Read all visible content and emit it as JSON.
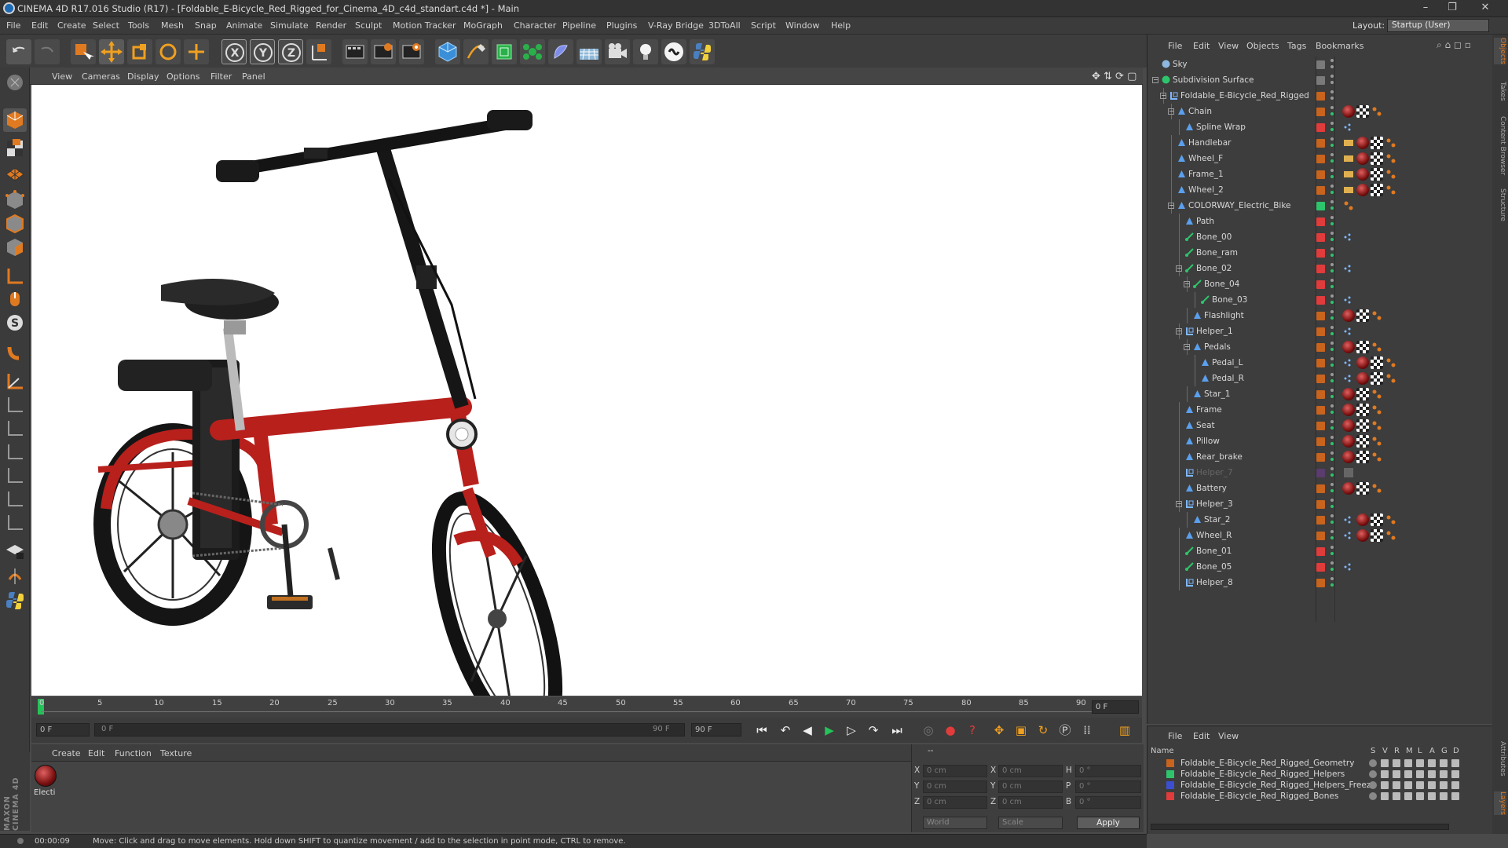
{
  "window": {
    "title": "CINEMA 4D R17.016 Studio (R17) - [Foldable_E-Bicycle_Red_Rigged_for_Cinema_4D_c4d_standart.c4d *] - Main",
    "controls": [
      "–",
      "❐",
      "✕"
    ]
  },
  "menubar": {
    "items": [
      "File",
      "Edit",
      "Create",
      "Select",
      "Tools",
      "Mesh",
      "Snap",
      "Animate",
      "Simulate",
      "Render",
      "Sculpt",
      "Motion Tracker",
      "MoGraph",
      "Character",
      "Pipeline",
      "Plugins",
      "V-Ray Bridge",
      "3DToAll",
      "Script",
      "Window",
      "Help"
    ],
    "layout_label": "Layout:",
    "layout_value": "Startup (User)"
  },
  "toolbar": {
    "axes": [
      "X",
      "Y",
      "Z"
    ]
  },
  "viewport": {
    "menu": [
      "View",
      "Cameras",
      "Display",
      "Options",
      "Filter",
      "Panel"
    ]
  },
  "timeline": {
    "ticks": [
      "0",
      "5",
      "10",
      "15",
      "20",
      "25",
      "30",
      "35",
      "40",
      "45",
      "50",
      "55",
      "60",
      "65",
      "70",
      "75",
      "80",
      "85",
      "90"
    ],
    "current_frame_display": "0 F",
    "start_field": "0 F",
    "range_start": "0 F",
    "range_end": "90 F",
    "end_field": "90 F"
  },
  "materials": {
    "menu": [
      "Create",
      "Edit",
      "Function",
      "Texture"
    ],
    "items": [
      {
        "label": "Electi"
      }
    ]
  },
  "coordinates": {
    "header": "--",
    "labels": {
      "x": "X",
      "y": "Y",
      "z": "Z",
      "x2": "X",
      "y2": "Y",
      "z2": "Z",
      "h": "H",
      "p": "P",
      "b": "B"
    },
    "pos_values": [
      "0 cm",
      "0 cm",
      "0 cm"
    ],
    "size_values": [
      "0 cm",
      "0 cm",
      "0 cm"
    ],
    "rot_values": [
      "0 °",
      "0 °",
      "0 °"
    ],
    "mode_select": "World",
    "scale_select": "Scale",
    "apply_label": "Apply"
  },
  "status": {
    "time": "00:00:09",
    "message": "Move: Click and drag to move elements. Hold down SHIFT to quantize movement / add to the selection in point mode, CTRL to remove."
  },
  "object_manager": {
    "menu": [
      "File",
      "Edit",
      "View",
      "Objects",
      "Tags",
      "Bookmarks"
    ],
    "objects": [
      {
        "name": "Sky",
        "depth": 0,
        "color": "#7a7a7a"
      },
      {
        "name": "Subdivision Surface",
        "depth": 0,
        "color": "#7a7a7a"
      },
      {
        "name": "Foldable_E-Bicycle_Red_Rigged",
        "depth": 1,
        "color": "#c8641e"
      },
      {
        "name": "Chain",
        "depth": 2,
        "color": "#c8641e"
      },
      {
        "name": "Spline Wrap",
        "depth": 3,
        "color": "#e03c3c"
      },
      {
        "name": "Handlebar",
        "depth": 2,
        "color": "#c8641e"
      },
      {
        "name": "Wheel_F",
        "depth": 2,
        "color": "#c8641e"
      },
      {
        "name": "Frame_1",
        "depth": 2,
        "color": "#c8641e"
      },
      {
        "name": "Wheel_2",
        "depth": 2,
        "color": "#c8641e"
      },
      {
        "name": "COLORWAY_Electric_Bike",
        "depth": 2,
        "color": "#2ec46b"
      },
      {
        "name": "Path",
        "depth": 3,
        "color": "#e03c3c"
      },
      {
        "name": "Bone_00",
        "depth": 3,
        "color": "#e03c3c"
      },
      {
        "name": "Bone_ram",
        "depth": 3,
        "color": "#e03c3c"
      },
      {
        "name": "Bone_02",
        "depth": 3,
        "color": "#e03c3c"
      },
      {
        "name": "Bone_04",
        "depth": 4,
        "color": "#e03c3c"
      },
      {
        "name": "Bone_03",
        "depth": 5,
        "color": "#e03c3c"
      },
      {
        "name": "Flashlight",
        "depth": 4,
        "color": "#c8641e"
      },
      {
        "name": "Helper_1",
        "depth": 3,
        "color": "#c8641e"
      },
      {
        "name": "Pedals",
        "depth": 4,
        "color": "#c8641e"
      },
      {
        "name": "Pedal_L",
        "depth": 5,
        "color": "#c8641e"
      },
      {
        "name": "Pedal_R",
        "depth": 5,
        "color": "#c8641e"
      },
      {
        "name": "Star_1",
        "depth": 4,
        "color": "#c8641e"
      },
      {
        "name": "Frame",
        "depth": 3,
        "color": "#c8641e"
      },
      {
        "name": "Seat",
        "depth": 3,
        "color": "#c8641e"
      },
      {
        "name": "Pillow",
        "depth": 3,
        "color": "#c8641e"
      },
      {
        "name": "Rear_brake",
        "depth": 3,
        "color": "#c8641e"
      },
      {
        "name": "Helper_7",
        "depth": 3,
        "color": "#5a3c6e"
      },
      {
        "name": "Battery",
        "depth": 3,
        "color": "#c8641e"
      },
      {
        "name": "Helper_3",
        "depth": 3,
        "color": "#c8641e"
      },
      {
        "name": "Star_2",
        "depth": 4,
        "color": "#c8641e"
      },
      {
        "name": "Wheel_R",
        "depth": 3,
        "color": "#c8641e"
      },
      {
        "name": "Bone_01",
        "depth": 3,
        "color": "#e03c3c"
      },
      {
        "name": "Bone_05",
        "depth": 3,
        "color": "#e03c3c"
      },
      {
        "name": "Helper_8",
        "depth": 3,
        "color": "#c8641e"
      }
    ]
  },
  "layer_manager": {
    "menu": [
      "File",
      "Edit",
      "View"
    ],
    "header_name": "Name",
    "header_cols": [
      "S",
      "V",
      "R",
      "M",
      "L",
      "A",
      "G",
      "D"
    ],
    "layers": [
      {
        "name": "Foldable_E-Bicycle_Red_Rigged_Geometry",
        "color": "#c8641e"
      },
      {
        "name": "Foldable_E-Bicycle_Red_Rigged_Helpers",
        "color": "#2ec46b"
      },
      {
        "name": "Foldable_E-Bicycle_Red_Rigged_Helpers_Freeze",
        "color": "#3b4fd0"
      },
      {
        "name": "Foldable_E-Bicycle_Red_Rigged_Bones",
        "color": "#e03c3c"
      }
    ]
  },
  "side_tabs": [
    "Objects",
    "Takes",
    "Content Browser",
    "Structure",
    "Attributes",
    "Layers"
  ],
  "branding": "MAXON CINEMA 4D"
}
